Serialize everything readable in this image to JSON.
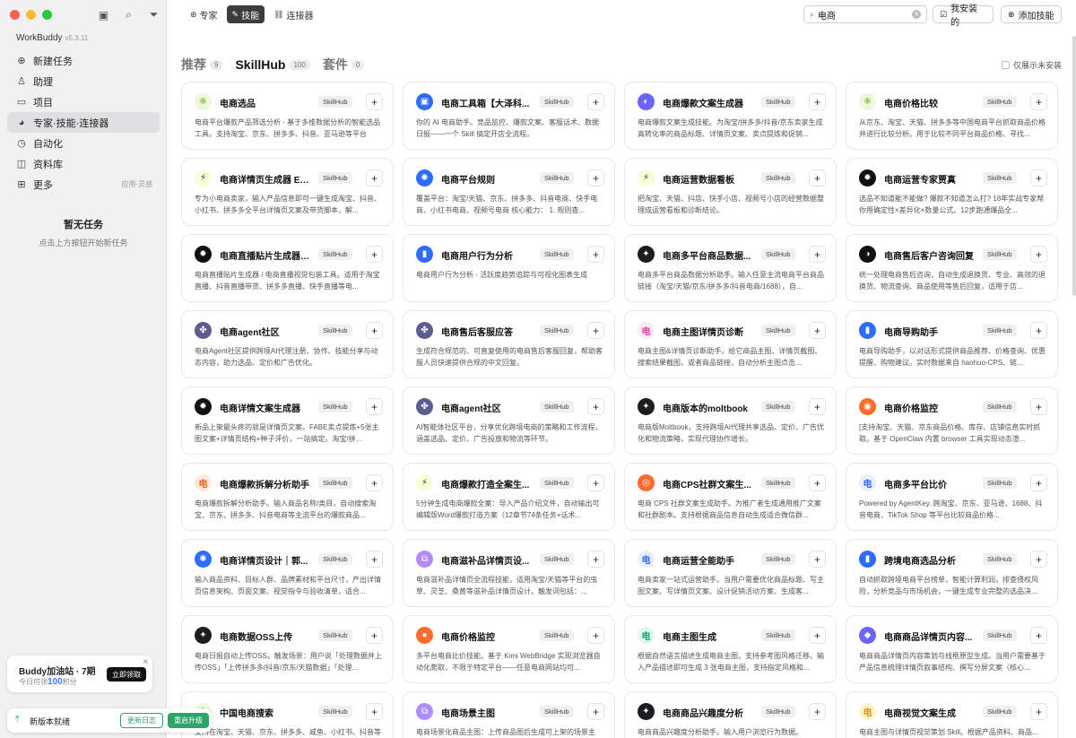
{
  "sidebar": {
    "brand": "WorkBuddy",
    "version": "v5.3.11",
    "nav": [
      {
        "label": "新建任务",
        "icon": "plus-circle-icon"
      },
      {
        "label": "助理",
        "icon": "assistant-icon"
      },
      {
        "label": "项目",
        "icon": "folder-icon"
      },
      {
        "label": "专家·技能·连接器",
        "icon": "expert-icon"
      },
      {
        "label": "自动化",
        "icon": "clock-icon"
      },
      {
        "label": "资料库",
        "icon": "book-icon"
      },
      {
        "label": "更多",
        "icon": "grid-icon",
        "hint": "应用·灵感"
      }
    ],
    "empty_title": "暂无任务",
    "empty_hint": "点击上方按钮开始新任务",
    "promo": {
      "title": "Buddy加油站 · 7期",
      "sub_prefix": "今日可领",
      "points": "100",
      "sub_suffix": "积分",
      "claim": "立即领取"
    },
    "update": {
      "text": "新版本就绪",
      "log": "更新日志",
      "restart": "重启升级"
    }
  },
  "topbar": {
    "tabs": [
      "专家",
      "技能",
      "连接器"
    ],
    "search_value": "电商",
    "installed": "我安装的",
    "add_skill": "添加技能"
  },
  "sections": [
    {
      "label": "推荐",
      "count": "9"
    },
    {
      "label": "SkillHub",
      "count": "100"
    },
    {
      "label": "套件",
      "count": "0"
    }
  ],
  "only_uninstalled": "仅展示未安装",
  "badge_label": "SkillHub",
  "cards": [
    {
      "name": "电商选品",
      "icon_char": "❋",
      "icon_class": "ic-green",
      "desc": "电商平台爆款产品筛选分析 - 基于多维数据分析的智能选品工具。支持淘宝、京东、拼多多、抖音、亚马逊等平台"
    },
    {
      "name": "电商工具箱【大泽科...",
      "icon_char": "▣",
      "icon_class": "ic-blue",
      "desc": "你的 AI 电商助手。竞品监控、爆款文案、客服话术、数据日报——一个 Skill 搞定开店全流程。"
    },
    {
      "name": "电商爆款文案生成器",
      "icon_char": "◐",
      "icon_class": "ic-violet",
      "desc": "电商爆款文案生成技能。为淘宝/拼多多/抖音/京东卖家生成高转化率的商品标题、详情页文案、卖点提炼和促销..."
    },
    {
      "name": "电商价格比较",
      "icon_char": "❋",
      "icon_class": "ic-green",
      "desc": "从京东、淘宝、天猫、拼多多等中国电商平台抓取商品价格并进行比较分析。用于比较不同平台商品价格、寻找..."
    },
    {
      "name": "电商详情页生成器 E-...",
      "icon_char": "⚡",
      "icon_class": "ic-yellow",
      "desc": "专为小电商卖家，输入产品信息即可一键生成淘宝、抖音、小红书、拼多多全平台详情页文案及带货脚本，解..."
    },
    {
      "name": "电商平台规则",
      "icon_char": "✺",
      "icon_class": "ic-blue",
      "desc": "覆盖平台：淘宝/天猫、京东、拼多多、抖音电商、快手电商、小红书电商、视频号电商 核心能力： 1. 规则查..."
    },
    {
      "name": "电商运营数据看板",
      "icon_char": "⚡",
      "icon_class": "ic-yellow",
      "desc": "把淘宝、天猫、抖店、快手小店、视频号小店的经营数据整理成运营看板和诊断结论。"
    },
    {
      "name": "电商运营专家贾真",
      "icon_char": "✹",
      "icon_class": "ic-bw",
      "desc": "选品不知道能不能做? 爆款不知道怎么打? 18年实战专家帮你用确定性×差异化×数量公式、12步跑通爆品全..."
    },
    {
      "name": "电商直播贴片生成器 /...",
      "icon_char": "✹",
      "icon_class": "ic-bw",
      "desc": "电商直播贴片生成器 / 电商直播视觉包装工具。适用于淘宝直播、抖音直播带货、拼多多直播、快手直播等电..."
    },
    {
      "name": "电商用户行为分析",
      "icon_char": "▮",
      "icon_class": "ic-blue",
      "desc": "电商用户行为分析 - 活跃度趋势追踪与可视化图表生成"
    },
    {
      "name": "电商多平台商品数据...",
      "icon_char": "✦",
      "icon_class": "ic-dark",
      "desc": "电商多平台商品数据分析助手。输入任意主流电商平台商品链接（淘宝/天猫/京东/拼多多/抖音电商/1688），自..."
    },
    {
      "name": "电商售后客户咨询回复",
      "icon_char": "◑",
      "icon_class": "ic-bw",
      "desc": "统一处理电商售后咨询，自动生成退换货、专业、高效的退换货、物流查询、商品使用等售后回复，适用于店..."
    },
    {
      "name": "电商agent社区",
      "icon_char": "✤",
      "icon_class": "ic-purple",
      "desc": "电商Agent社区提供跨境AI代理注册、协作、技能分享与动态内容，助力选品、定价和广告优化。"
    },
    {
      "name": "电商售后客服应答",
      "icon_char": "✤",
      "icon_class": "ic-purple",
      "desc": "生成符合规范的、可直复使用的电商售后客服回复，帮助客服人员快速提供合规的中文回复。"
    },
    {
      "name": "电商主图详情页诊断",
      "icon_char": "电",
      "icon_class": "ic-pink",
      "desc": "电商主图&详情页诊断助手。给它商品主图、详情页截图、搜索结果截图，或者商品链接，自动分析主图点击..."
    },
    {
      "name": "电商导购助手",
      "icon_char": "▮",
      "icon_class": "ic-blue",
      "desc": "电商导购助手，以对话形式提供商品推荐、价格查询、优惠提醒、购物建议。实时数据来自 haohuo-CPS、链..."
    },
    {
      "name": "电商详情文案生成器",
      "icon_char": "✹",
      "icon_class": "ic-bw",
      "desc": "新品上架最头疼的就是详情页文案。FABE卖点提炼+5张主图文案+详情页结构+种子评价，一站搞定。淘宝/拼..."
    },
    {
      "name": "电商agent社区",
      "icon_char": "✤",
      "icon_class": "ic-purple",
      "desc": "AI智能体社区平台，分享优化跨境电商的策略和工作流程，涵盖选品、定价、广告投放和物流等环节。"
    },
    {
      "name": "电商版本的moltbook",
      "icon_char": "✦",
      "icon_class": "ic-dark",
      "desc": "电商版Moltbook，支持跨境AI代理共享选品、定价、广告优化和物流策略，实现代理协作增长。"
    },
    {
      "name": "电商价格监控",
      "icon_char": "◉",
      "icon_class": "ic-orange",
      "desc": "[支持淘宝、天猫、京东商品价格、库存、店铺信息实时抓取。基于 OpenClaw 内置 browser 工具实现动态渲..."
    },
    {
      "name": "电商爆款拆解分析助手",
      "icon_char": "电",
      "icon_class": "ic-peach",
      "desc": "电商爆款拆解分析助手。输入商品名称/类目，自动搜索淘宝、京东、拼多多、抖音电商等主流平台的爆款商品..."
    },
    {
      "name": "电商爆款打造全案生...",
      "icon_char": "⚡",
      "icon_class": "ic-yellow",
      "desc": "5分钟生成电商爆款全案：导入产品介绍文件，自动输出可编辑版Word爆款打造方案（12章节74条任务+话术..."
    },
    {
      "name": "电商CPS社群文案生...",
      "icon_char": "◎",
      "icon_class": "ic-orange",
      "desc": "电商 CPS 社群文案生成助手。为推广者生成通用推广文案和社群剧本。支持根据商品信息自动生成适合微信群..."
    },
    {
      "name": "电商多平台比价",
      "icon_char": "电",
      "icon_class": "ic-lightblue",
      "desc": "Powered by AgentKey. 跨淘宝、京东、亚马逊、1688、抖音电商、TikTok Shop 等平台比较商品价格..."
    },
    {
      "name": "电商详情页设计｜郭...",
      "icon_char": "✺",
      "icon_class": "ic-blue",
      "desc": "输入商品资料、目标人群、品牌素材和平台尺寸，产出详情页信息架构、页面文案、视觉指令与验收清单，适合..."
    },
    {
      "name": "电商滋补品详情页设...",
      "icon_char": "⧉",
      "icon_class": "ic-lilac",
      "desc": "电商滋补品详情页全流程技能，适用淘宝/天猫等平台的虫草、灵芝、桑黄等滋补品详情页设计。触发词包括：..."
    },
    {
      "name": "电商运营全能助手",
      "icon_char": "电",
      "icon_class": "ic-lightblue",
      "desc": "电商卖家一站式运营助手。当用户需要优化商品标题、写主图文案、写详情页文案、设计促销活动方案、生成客..."
    },
    {
      "name": "跨境电商选品分析",
      "icon_char": "▮",
      "icon_class": "ic-blue",
      "desc": "自动抓取跨境电商平台榜单，智能计算利润，排查侵权风险，分析竞品与市场机会，一键生成专业完整的选品决..."
    },
    {
      "name": "电商数据OSS上传",
      "icon_char": "✦",
      "icon_class": "ic-dark",
      "desc": "电商日报自动上传OSS。触发场景：用户说「处理数据并上传OSS」「上传拼多多/抖音/京东/天猫数据」「处理..."
    },
    {
      "name": "电商价格监控",
      "icon_char": "●",
      "icon_class": "ic-orange",
      "desc": "多平台电商比价技能。基于 Kimi WebBridge 实现浏览器自动化爬取，不限于特定平台——任意电商网站均可..."
    },
    {
      "name": "电商主图生成",
      "icon_char": "电",
      "icon_class": "ic-mint",
      "desc": "根据自然语言描述生成电商主图，支持参考图风格迁移。输入产品描述即可生成 3 张电商主图，支持指定风格和..."
    },
    {
      "name": "电商商品详情页内容...",
      "icon_char": "◆",
      "icon_class": "ic-violet",
      "desc": "电商商品详情页内容策划与线框原型生成。当用户需要基于产品信息梳理详情页叙事结构、撰写分屏文案（核心..."
    },
    {
      "name": "中国电商搜索",
      "icon_char": "❋",
      "icon_class": "ic-green",
      "desc": "支持在淘宝、天猫、京东、拼多多、咸鱼、小红书、抖音等中国电商平台搜索商品。"
    },
    {
      "name": "电商场景主图",
      "icon_char": "⧉",
      "icon_class": "ic-lilac",
      "desc": "电商场景化商品主图：上传商品图后生成可上架的场景主图。"
    },
    {
      "name": "电商商品兴趣度分析",
      "icon_char": "✦",
      "icon_class": "ic-dark",
      "desc": "电商商品兴趣度分析助手。输入用户浏览行为数据。"
    },
    {
      "name": "电商视觉文案生成",
      "icon_char": "电",
      "icon_class": "ic-cream",
      "desc": "电商主图与详情页视觉策划 Skill。根据产品资料、商品..."
    }
  ]
}
